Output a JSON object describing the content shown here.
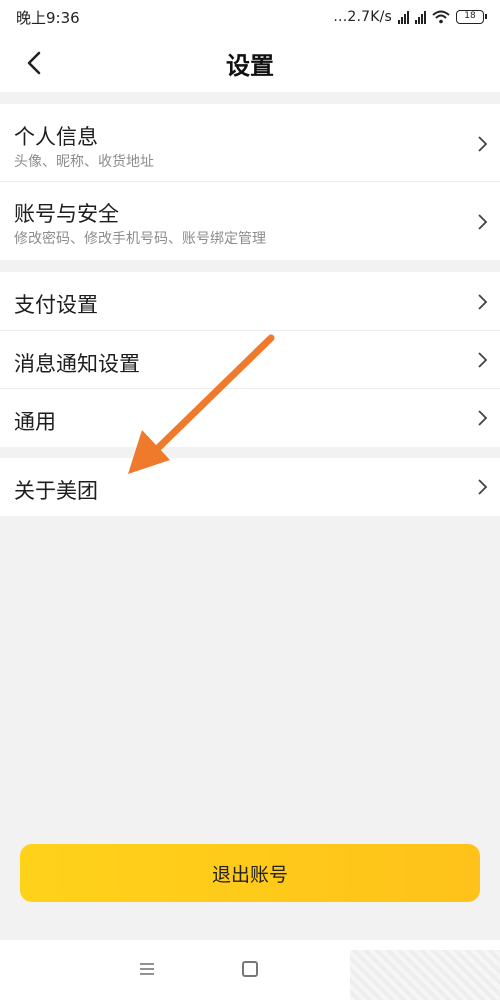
{
  "status_bar": {
    "time": "晚上9:36",
    "network_speed": "...2.7K/s",
    "battery": "18"
  },
  "nav": {
    "title": "设置"
  },
  "settings": {
    "personal_info": {
      "title": "个人信息",
      "subtitle": "头像、昵称、收货地址"
    },
    "account_security": {
      "title": "账号与安全",
      "subtitle": "修改密码、修改手机号码、账号绑定管理"
    },
    "payment": {
      "title": "支付设置"
    },
    "notifications": {
      "title": "消息通知设置"
    },
    "general": {
      "title": "通用"
    },
    "about": {
      "title": "关于美团"
    }
  },
  "logout_label": "退出账号",
  "colors": {
    "accent_yellow": "#ffc21a",
    "annotation_arrow": "#f07a2c",
    "page_background": "#f2f2f2"
  },
  "icons": [
    "back-chevron-icon",
    "chevron-right-icon",
    "signal-icon",
    "wifi-icon",
    "battery-icon",
    "menu-icon",
    "home-icon"
  ]
}
